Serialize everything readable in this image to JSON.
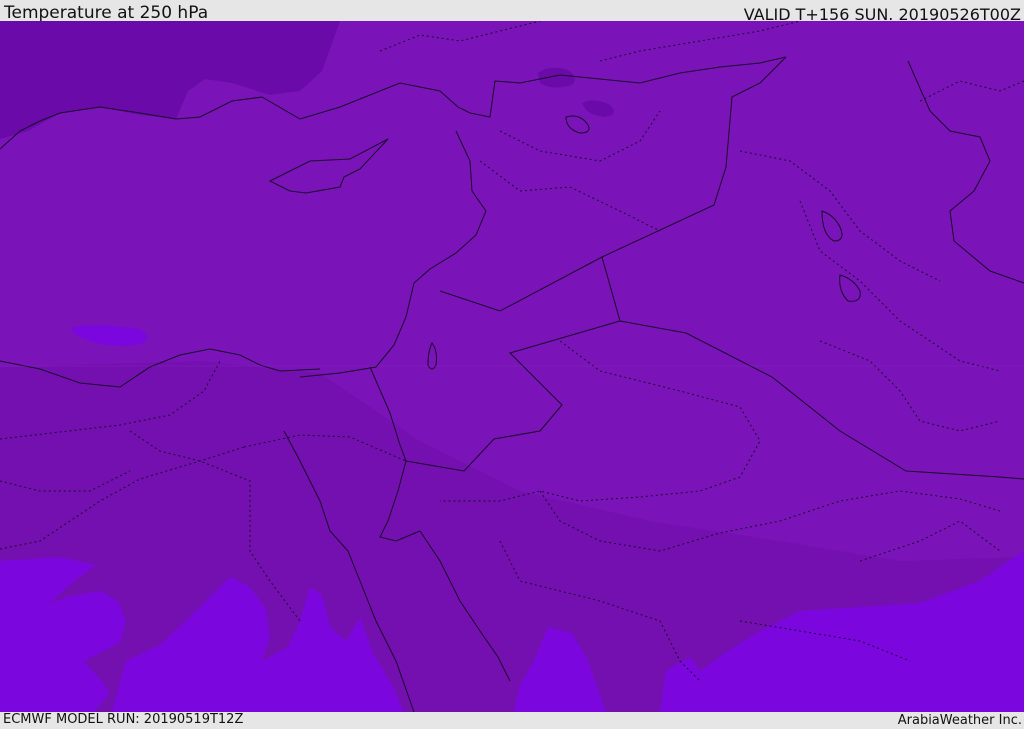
{
  "header": {
    "title": "Temperature at 250 hPa",
    "valid": "VALID T+156 SUN. 20190526T00Z"
  },
  "footer": {
    "model_run": "ECMWF MODEL RUN: 20190519T12Z",
    "credit": "ArabiaWeather Inc."
  },
  "colors": {
    "base_fill": "#7a14b8",
    "cold_fill": "#6a0aa8",
    "cool_fill": "#7410b0",
    "warm_fill": "#7c06de",
    "border": "#1a0a2a",
    "header_bg": "#e6e6e6"
  }
}
